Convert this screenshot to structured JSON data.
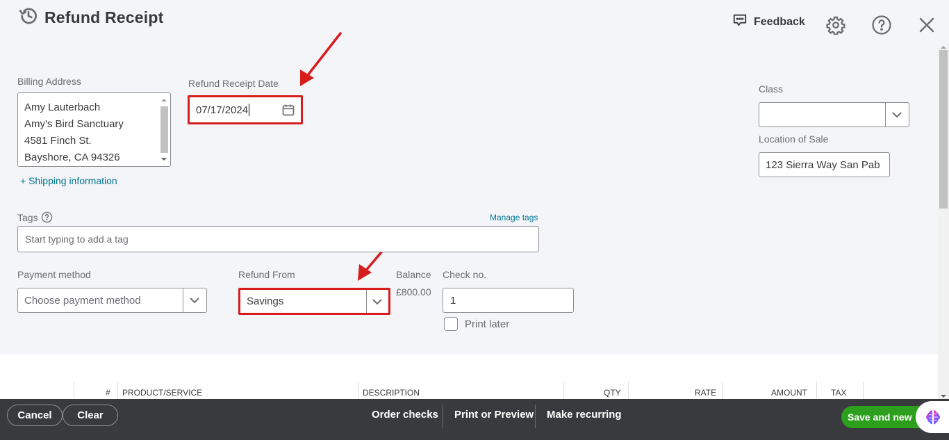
{
  "header": {
    "title": "Refund Receipt",
    "title_icon": "history-icon",
    "feedback_label": "Feedback",
    "icons": [
      "feedback-chat-icon",
      "gear-icon",
      "help-icon",
      "close-icon"
    ]
  },
  "billing": {
    "label": "Billing Address",
    "lines": [
      "Amy Lauterbach",
      "Amy's Bird Sanctuary",
      "4581 Finch St.",
      "Bayshore, CA  94326"
    ],
    "shipping_link": "+ Shipping information"
  },
  "date": {
    "label": "Refund Receipt Date",
    "value": "07/17/2024",
    "icon": "calendar-icon"
  },
  "class_field": {
    "label": "Class",
    "value": ""
  },
  "location": {
    "label": "Location of Sale",
    "value": "123 Sierra Way San Pab"
  },
  "tags": {
    "label": "Tags",
    "manage_link": "Manage tags",
    "placeholder": "Start typing to add a tag"
  },
  "payment": {
    "label": "Payment method",
    "placeholder": "Choose payment method"
  },
  "refund_from": {
    "label": "Refund From",
    "value": "Savings"
  },
  "balance": {
    "label": "Balance",
    "value": "£800.00"
  },
  "check": {
    "label": "Check no.",
    "value": "1",
    "print_later_label": "Print later",
    "print_later_checked": false
  },
  "table": {
    "columns": [
      "#",
      "PRODUCT/SERVICE",
      "DESCRIPTION",
      "QTY",
      "RATE",
      "AMOUNT",
      "TAX"
    ]
  },
  "footer": {
    "cancel": "Cancel",
    "clear": "Clear",
    "order_checks": "Order checks",
    "print_preview": "Print or Preview",
    "make_recurring": "Make recurring",
    "save_new": "Save and new"
  },
  "colors": {
    "highlight": "#d71c1c",
    "primary_green": "#2ca01c",
    "footer_bg": "#393a3d",
    "link_teal": "#00758f"
  }
}
